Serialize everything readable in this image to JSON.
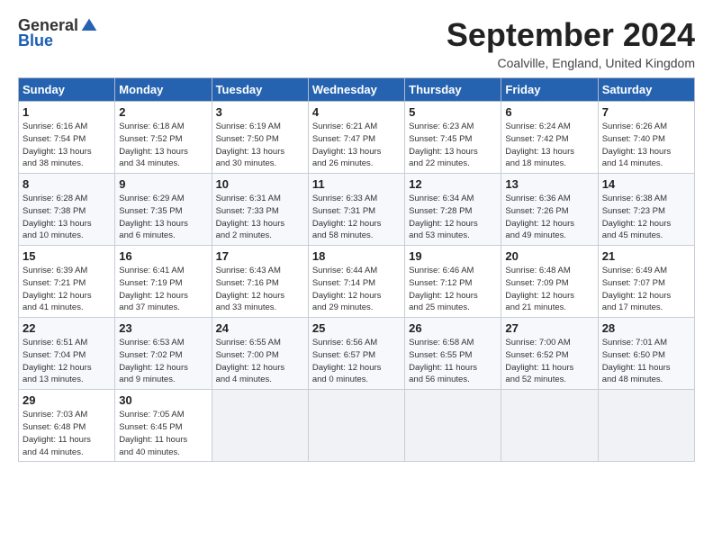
{
  "logo": {
    "general": "General",
    "blue": "Blue"
  },
  "header": {
    "month": "September 2024",
    "location": "Coalville, England, United Kingdom"
  },
  "weekdays": [
    "Sunday",
    "Monday",
    "Tuesday",
    "Wednesday",
    "Thursday",
    "Friday",
    "Saturday"
  ],
  "weeks": [
    [
      {
        "day": "1",
        "info": "Sunrise: 6:16 AM\nSunset: 7:54 PM\nDaylight: 13 hours\nand 38 minutes."
      },
      {
        "day": "2",
        "info": "Sunrise: 6:18 AM\nSunset: 7:52 PM\nDaylight: 13 hours\nand 34 minutes."
      },
      {
        "day": "3",
        "info": "Sunrise: 6:19 AM\nSunset: 7:50 PM\nDaylight: 13 hours\nand 30 minutes."
      },
      {
        "day": "4",
        "info": "Sunrise: 6:21 AM\nSunset: 7:47 PM\nDaylight: 13 hours\nand 26 minutes."
      },
      {
        "day": "5",
        "info": "Sunrise: 6:23 AM\nSunset: 7:45 PM\nDaylight: 13 hours\nand 22 minutes."
      },
      {
        "day": "6",
        "info": "Sunrise: 6:24 AM\nSunset: 7:42 PM\nDaylight: 13 hours\nand 18 minutes."
      },
      {
        "day": "7",
        "info": "Sunrise: 6:26 AM\nSunset: 7:40 PM\nDaylight: 13 hours\nand 14 minutes."
      }
    ],
    [
      {
        "day": "8",
        "info": "Sunrise: 6:28 AM\nSunset: 7:38 PM\nDaylight: 13 hours\nand 10 minutes."
      },
      {
        "day": "9",
        "info": "Sunrise: 6:29 AM\nSunset: 7:35 PM\nDaylight: 13 hours\nand 6 minutes."
      },
      {
        "day": "10",
        "info": "Sunrise: 6:31 AM\nSunset: 7:33 PM\nDaylight: 13 hours\nand 2 minutes."
      },
      {
        "day": "11",
        "info": "Sunrise: 6:33 AM\nSunset: 7:31 PM\nDaylight: 12 hours\nand 58 minutes."
      },
      {
        "day": "12",
        "info": "Sunrise: 6:34 AM\nSunset: 7:28 PM\nDaylight: 12 hours\nand 53 minutes."
      },
      {
        "day": "13",
        "info": "Sunrise: 6:36 AM\nSunset: 7:26 PM\nDaylight: 12 hours\nand 49 minutes."
      },
      {
        "day": "14",
        "info": "Sunrise: 6:38 AM\nSunset: 7:23 PM\nDaylight: 12 hours\nand 45 minutes."
      }
    ],
    [
      {
        "day": "15",
        "info": "Sunrise: 6:39 AM\nSunset: 7:21 PM\nDaylight: 12 hours\nand 41 minutes."
      },
      {
        "day": "16",
        "info": "Sunrise: 6:41 AM\nSunset: 7:19 PM\nDaylight: 12 hours\nand 37 minutes."
      },
      {
        "day": "17",
        "info": "Sunrise: 6:43 AM\nSunset: 7:16 PM\nDaylight: 12 hours\nand 33 minutes."
      },
      {
        "day": "18",
        "info": "Sunrise: 6:44 AM\nSunset: 7:14 PM\nDaylight: 12 hours\nand 29 minutes."
      },
      {
        "day": "19",
        "info": "Sunrise: 6:46 AM\nSunset: 7:12 PM\nDaylight: 12 hours\nand 25 minutes."
      },
      {
        "day": "20",
        "info": "Sunrise: 6:48 AM\nSunset: 7:09 PM\nDaylight: 12 hours\nand 21 minutes."
      },
      {
        "day": "21",
        "info": "Sunrise: 6:49 AM\nSunset: 7:07 PM\nDaylight: 12 hours\nand 17 minutes."
      }
    ],
    [
      {
        "day": "22",
        "info": "Sunrise: 6:51 AM\nSunset: 7:04 PM\nDaylight: 12 hours\nand 13 minutes."
      },
      {
        "day": "23",
        "info": "Sunrise: 6:53 AM\nSunset: 7:02 PM\nDaylight: 12 hours\nand 9 minutes."
      },
      {
        "day": "24",
        "info": "Sunrise: 6:55 AM\nSunset: 7:00 PM\nDaylight: 12 hours\nand 4 minutes."
      },
      {
        "day": "25",
        "info": "Sunrise: 6:56 AM\nSunset: 6:57 PM\nDaylight: 12 hours\nand 0 minutes."
      },
      {
        "day": "26",
        "info": "Sunrise: 6:58 AM\nSunset: 6:55 PM\nDaylight: 11 hours\nand 56 minutes."
      },
      {
        "day": "27",
        "info": "Sunrise: 7:00 AM\nSunset: 6:52 PM\nDaylight: 11 hours\nand 52 minutes."
      },
      {
        "day": "28",
        "info": "Sunrise: 7:01 AM\nSunset: 6:50 PM\nDaylight: 11 hours\nand 48 minutes."
      }
    ],
    [
      {
        "day": "29",
        "info": "Sunrise: 7:03 AM\nSunset: 6:48 PM\nDaylight: 11 hours\nand 44 minutes."
      },
      {
        "day": "30",
        "info": "Sunrise: 7:05 AM\nSunset: 6:45 PM\nDaylight: 11 hours\nand 40 minutes."
      },
      {
        "day": "",
        "info": ""
      },
      {
        "day": "",
        "info": ""
      },
      {
        "day": "",
        "info": ""
      },
      {
        "day": "",
        "info": ""
      },
      {
        "day": "",
        "info": ""
      }
    ]
  ]
}
